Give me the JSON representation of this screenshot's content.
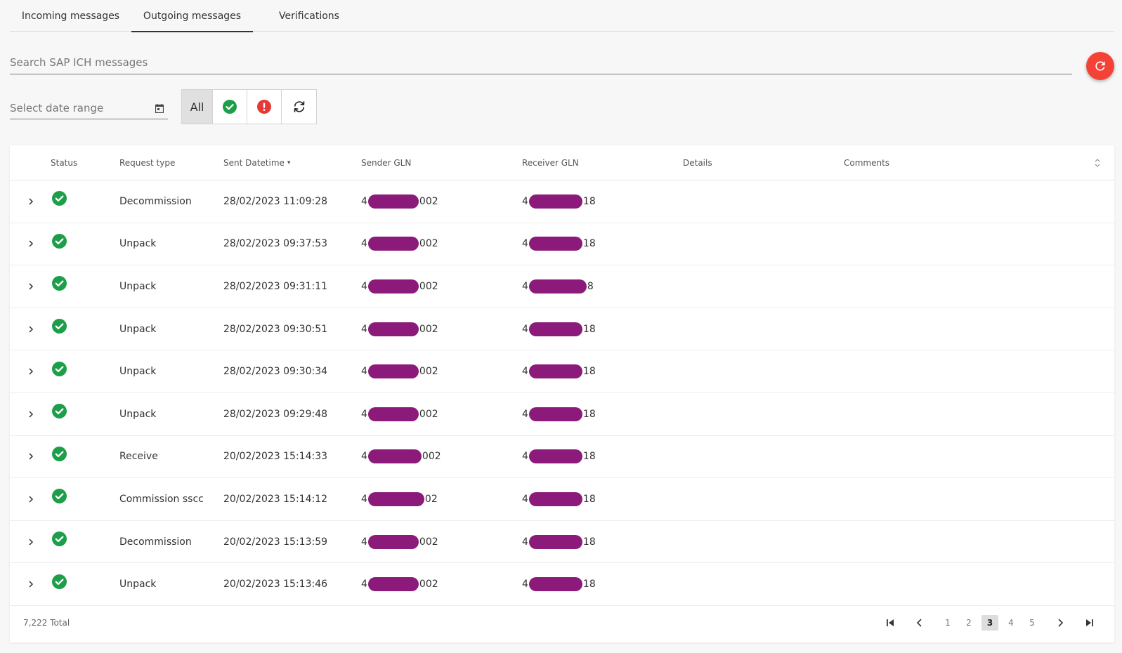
{
  "tabs": [
    {
      "label": "Incoming messages",
      "active": false
    },
    {
      "label": "Outgoing messages",
      "active": true
    },
    {
      "label": "Verifications",
      "active": false
    }
  ],
  "search": {
    "placeholder": "Search SAP ICH messages"
  },
  "date_range": {
    "placeholder": "Select date range"
  },
  "filters": {
    "all_label": "All"
  },
  "table": {
    "headers": {
      "status": "Status",
      "request_type": "Request type",
      "sent_datetime": "Sent Datetime",
      "sender_gln": "Sender GLN",
      "receiver_gln": "Receiver GLN",
      "details": "Details",
      "comments": "Comments"
    },
    "rows": [
      {
        "request_type": "Decommission",
        "sent_datetime": "28/02/2023 11:09:28",
        "sender_prefix": "4",
        "sender_suffix": "002",
        "receiver_prefix": "4",
        "receiver_suffix": "18"
      },
      {
        "request_type": "Unpack",
        "sent_datetime": "28/02/2023 09:37:53",
        "sender_prefix": "4",
        "sender_suffix": "002",
        "receiver_prefix": "4",
        "receiver_suffix": "18"
      },
      {
        "request_type": "Unpack",
        "sent_datetime": "28/02/2023 09:31:11",
        "sender_prefix": "4",
        "sender_suffix": "002",
        "receiver_prefix": "4",
        "receiver_suffix": "8"
      },
      {
        "request_type": "Unpack",
        "sent_datetime": "28/02/2023 09:30:51",
        "sender_prefix": "4",
        "sender_suffix": "002",
        "receiver_prefix": "4",
        "receiver_suffix": "18"
      },
      {
        "request_type": "Unpack",
        "sent_datetime": "28/02/2023 09:30:34",
        "sender_prefix": "4",
        "sender_suffix": "002",
        "receiver_prefix": "4",
        "receiver_suffix": "18"
      },
      {
        "request_type": "Unpack",
        "sent_datetime": "28/02/2023 09:29:48",
        "sender_prefix": "4",
        "sender_suffix": "002",
        "receiver_prefix": "4",
        "receiver_suffix": "18"
      },
      {
        "request_type": "Receive",
        "sent_datetime": "20/02/2023 15:14:33",
        "sender_prefix": "4",
        "sender_suffix": "002",
        "receiver_prefix": "4",
        "receiver_suffix": "18"
      },
      {
        "request_type": "Commission sscc",
        "sent_datetime": "20/02/2023 15:14:12",
        "sender_prefix": "4",
        "sender_suffix": "02",
        "receiver_prefix": "4",
        "receiver_suffix": "18"
      },
      {
        "request_type": "Decommission",
        "sent_datetime": "20/02/2023 15:13:59",
        "sender_prefix": "4",
        "sender_suffix": "002",
        "receiver_prefix": "4",
        "receiver_suffix": "18"
      },
      {
        "request_type": "Unpack",
        "sent_datetime": "20/02/2023 15:13:46",
        "sender_prefix": "4",
        "sender_suffix": "002",
        "receiver_prefix": "4",
        "receiver_suffix": "18"
      }
    ]
  },
  "footer": {
    "total": "7,222 Total",
    "pages": [
      "1",
      "2",
      "3",
      "4",
      "5"
    ],
    "current_page": "3"
  },
  "colors": {
    "success": "#1e9e4a",
    "error": "#e53935",
    "refresh": "#f44336",
    "redaction": "#8b1a7a"
  },
  "icons": {
    "success": "check-circle-icon",
    "error": "exclamation-circle-icon",
    "sync": "sync-icon",
    "refresh": "refresh-icon",
    "calendar": "calendar-icon"
  }
}
